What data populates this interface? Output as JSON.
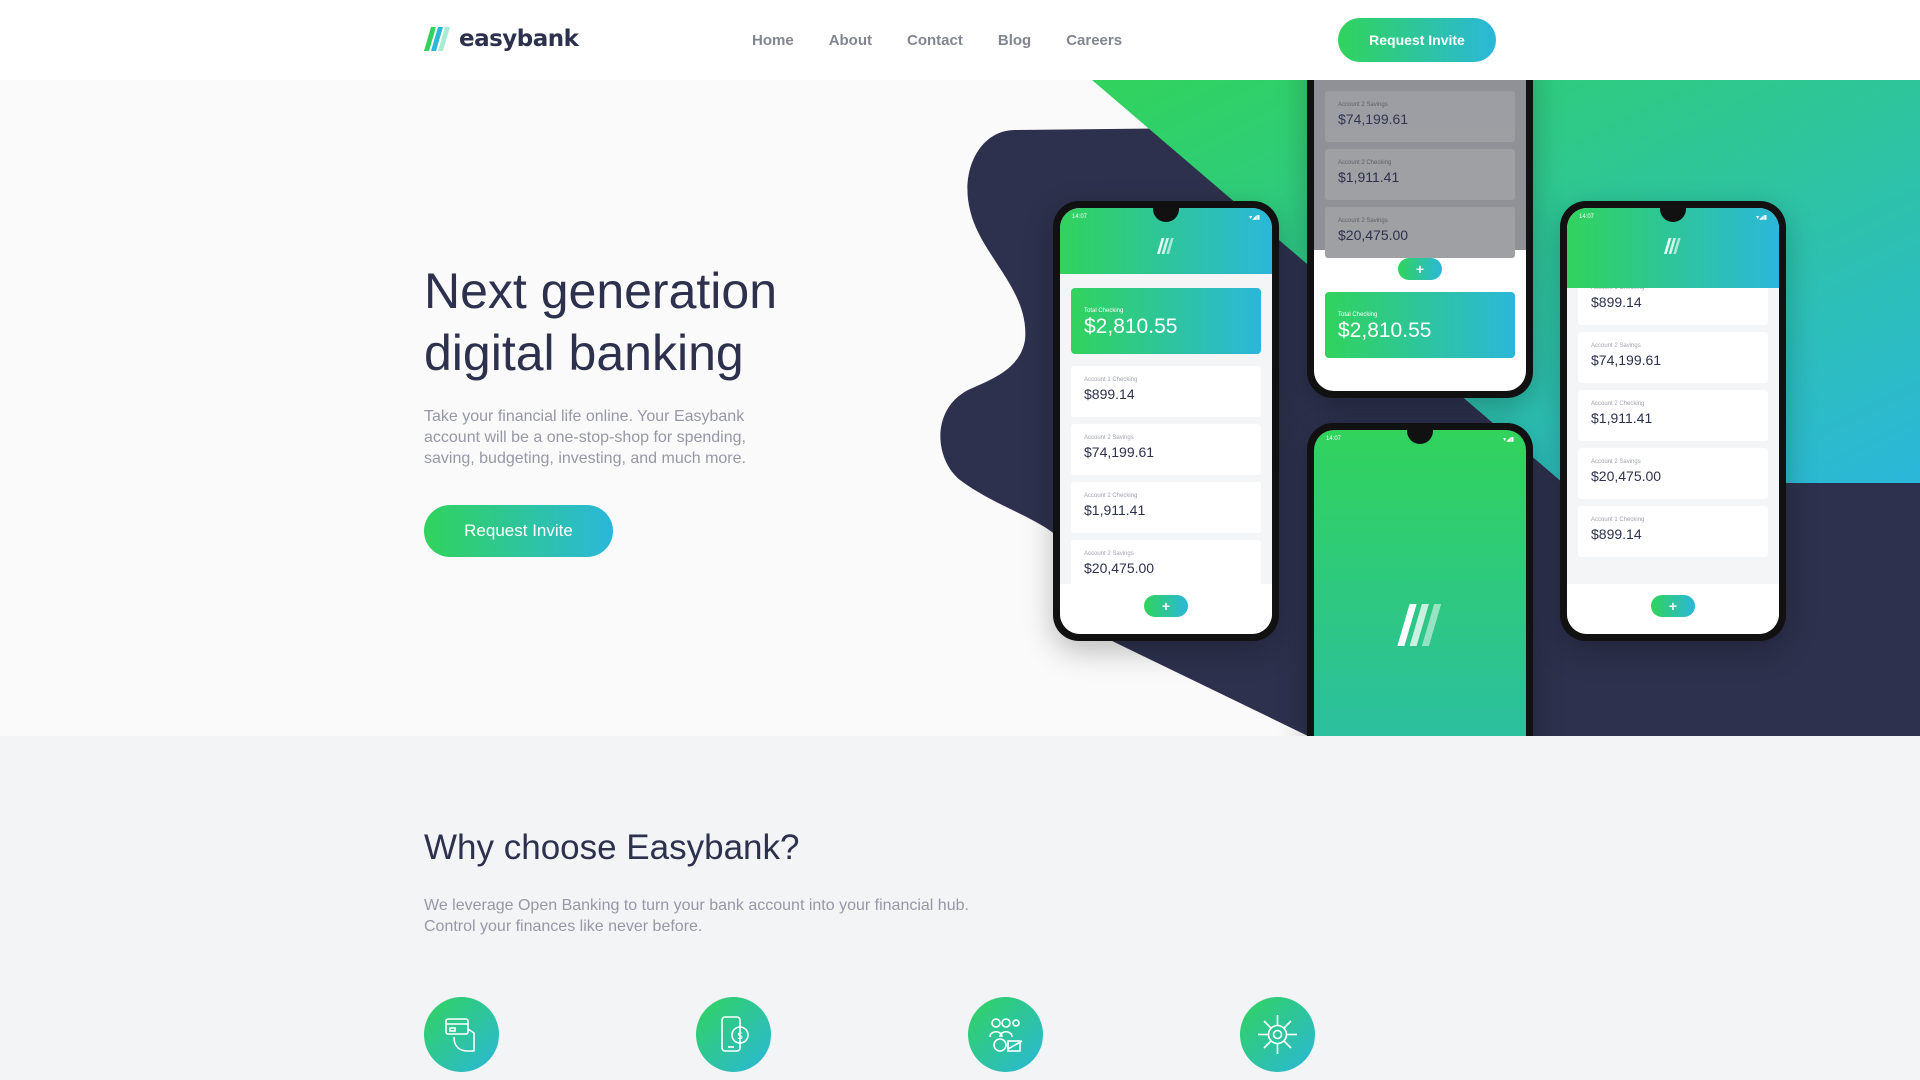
{
  "brand": {
    "name": "easybank",
    "accent_green": "#31d35c",
    "accent_cyan": "#2bb7da",
    "navy": "#2d314d"
  },
  "nav": {
    "items": [
      "Home",
      "About",
      "Contact",
      "Blog",
      "Careers"
    ],
    "cta": "Request Invite"
  },
  "hero": {
    "title_line1": "Next generation",
    "title_line2": "digital banking",
    "description": "Take your financial life online. Your Easybank account will be a one-stop-shop for spending, saving, budgeting, investing, and much more.",
    "cta": "Request Invite"
  },
  "mockups": {
    "status_time": "14:07",
    "total_label": "Total Checking",
    "total_value": "$2,810.55",
    "accounts": [
      {
        "label": "Account 1 Checking",
        "value": "$899.14"
      },
      {
        "label": "Account 2 Savings",
        "value": "$74,199.61"
      },
      {
        "label": "Account 2 Checking",
        "value": "$1,911.41"
      },
      {
        "label": "Account 2 Savings",
        "value": "$20,475.00"
      },
      {
        "label": "Account 1 Checking",
        "value": "$899.14"
      }
    ]
  },
  "why": {
    "title": "Why choose Easybank?",
    "description_line1": "We leverage Open Banking to turn your bank account into your financial hub.",
    "description_line2": "Control your finances like never before.",
    "features": [
      {
        "icon": "online-banking-icon"
      },
      {
        "icon": "budgeting-icon"
      },
      {
        "icon": "onboarding-icon"
      },
      {
        "icon": "open-api-icon"
      }
    ]
  }
}
